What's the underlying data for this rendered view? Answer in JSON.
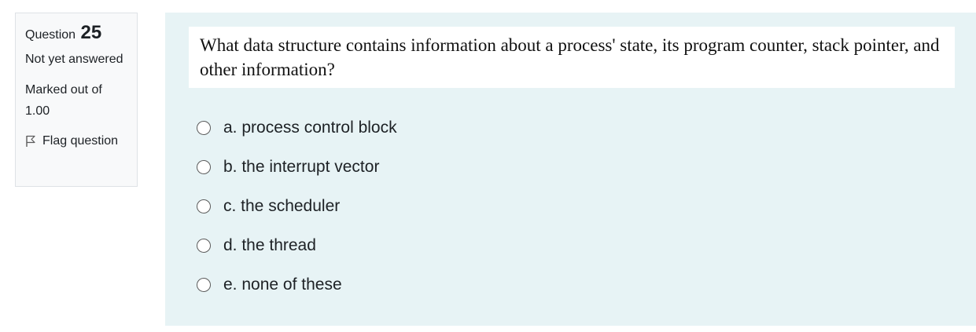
{
  "info": {
    "question_label": "Question",
    "question_number": "25",
    "state": "Not yet answered",
    "grade": "Marked out of 1.00",
    "flag_label": "Flag question"
  },
  "question": {
    "text": "What data structure contains information about a process' state, its program counter, stack pointer, and other information?"
  },
  "answers": [
    "a. process control block",
    "b. the interrupt vector",
    "c. the scheduler",
    "d. the thread",
    "e. none of these"
  ],
  "colors": {
    "content_bg": "#e7f3f5",
    "info_bg": "#f8f9fa"
  }
}
